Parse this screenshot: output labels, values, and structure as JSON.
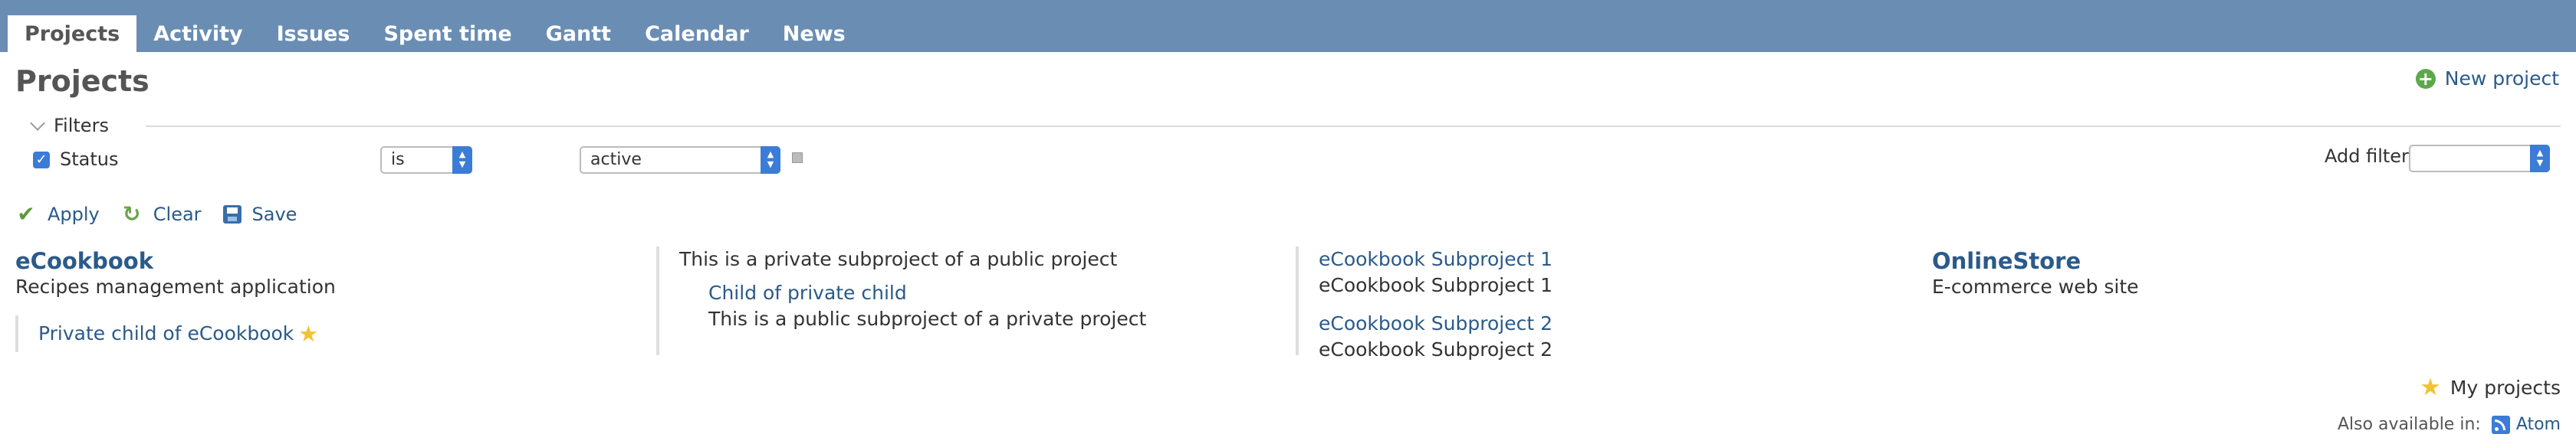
{
  "tabs": [
    {
      "label": "Projects",
      "selected": true
    },
    {
      "label": "Activity"
    },
    {
      "label": "Issues"
    },
    {
      "label": "Spent time"
    },
    {
      "label": "Gantt"
    },
    {
      "label": "Calendar"
    },
    {
      "label": "News"
    }
  ],
  "page": {
    "title": "Projects",
    "new_project_label": "New project"
  },
  "filters": {
    "legend": "Filters",
    "status": {
      "label": "Status",
      "checked": true,
      "operator": "is",
      "value": "active"
    },
    "add_filter_label": "Add filter",
    "add_filter_value": ""
  },
  "actions": {
    "apply": "Apply",
    "clear": "Clear",
    "save": "Save"
  },
  "projects": {
    "col1": {
      "name": "eCookbook",
      "description": "Recipes management application",
      "child": "Private child of eCookbook"
    },
    "col2": {
      "description": "This is a private subproject of a public project",
      "child": "Child of private child",
      "child_description": "This is a public subproject of a private project"
    },
    "col3": {
      "sub1": "eCookbook Subproject 1",
      "sub1_description": "eCookbook Subproject 1",
      "sub2": "eCookbook Subproject 2",
      "sub2_description": "eCookbook Subproject 2"
    },
    "col4": {
      "name": "OnlineStore",
      "description": "E-commerce web site"
    }
  },
  "footer": {
    "my_projects": "My projects",
    "also_available": "Also available in:",
    "atom": "Atom"
  },
  "colors": {
    "topbar": "#6a8db3",
    "link": "#2a5a8a",
    "accent": "#3b7cd6",
    "star": "#f2c233"
  }
}
